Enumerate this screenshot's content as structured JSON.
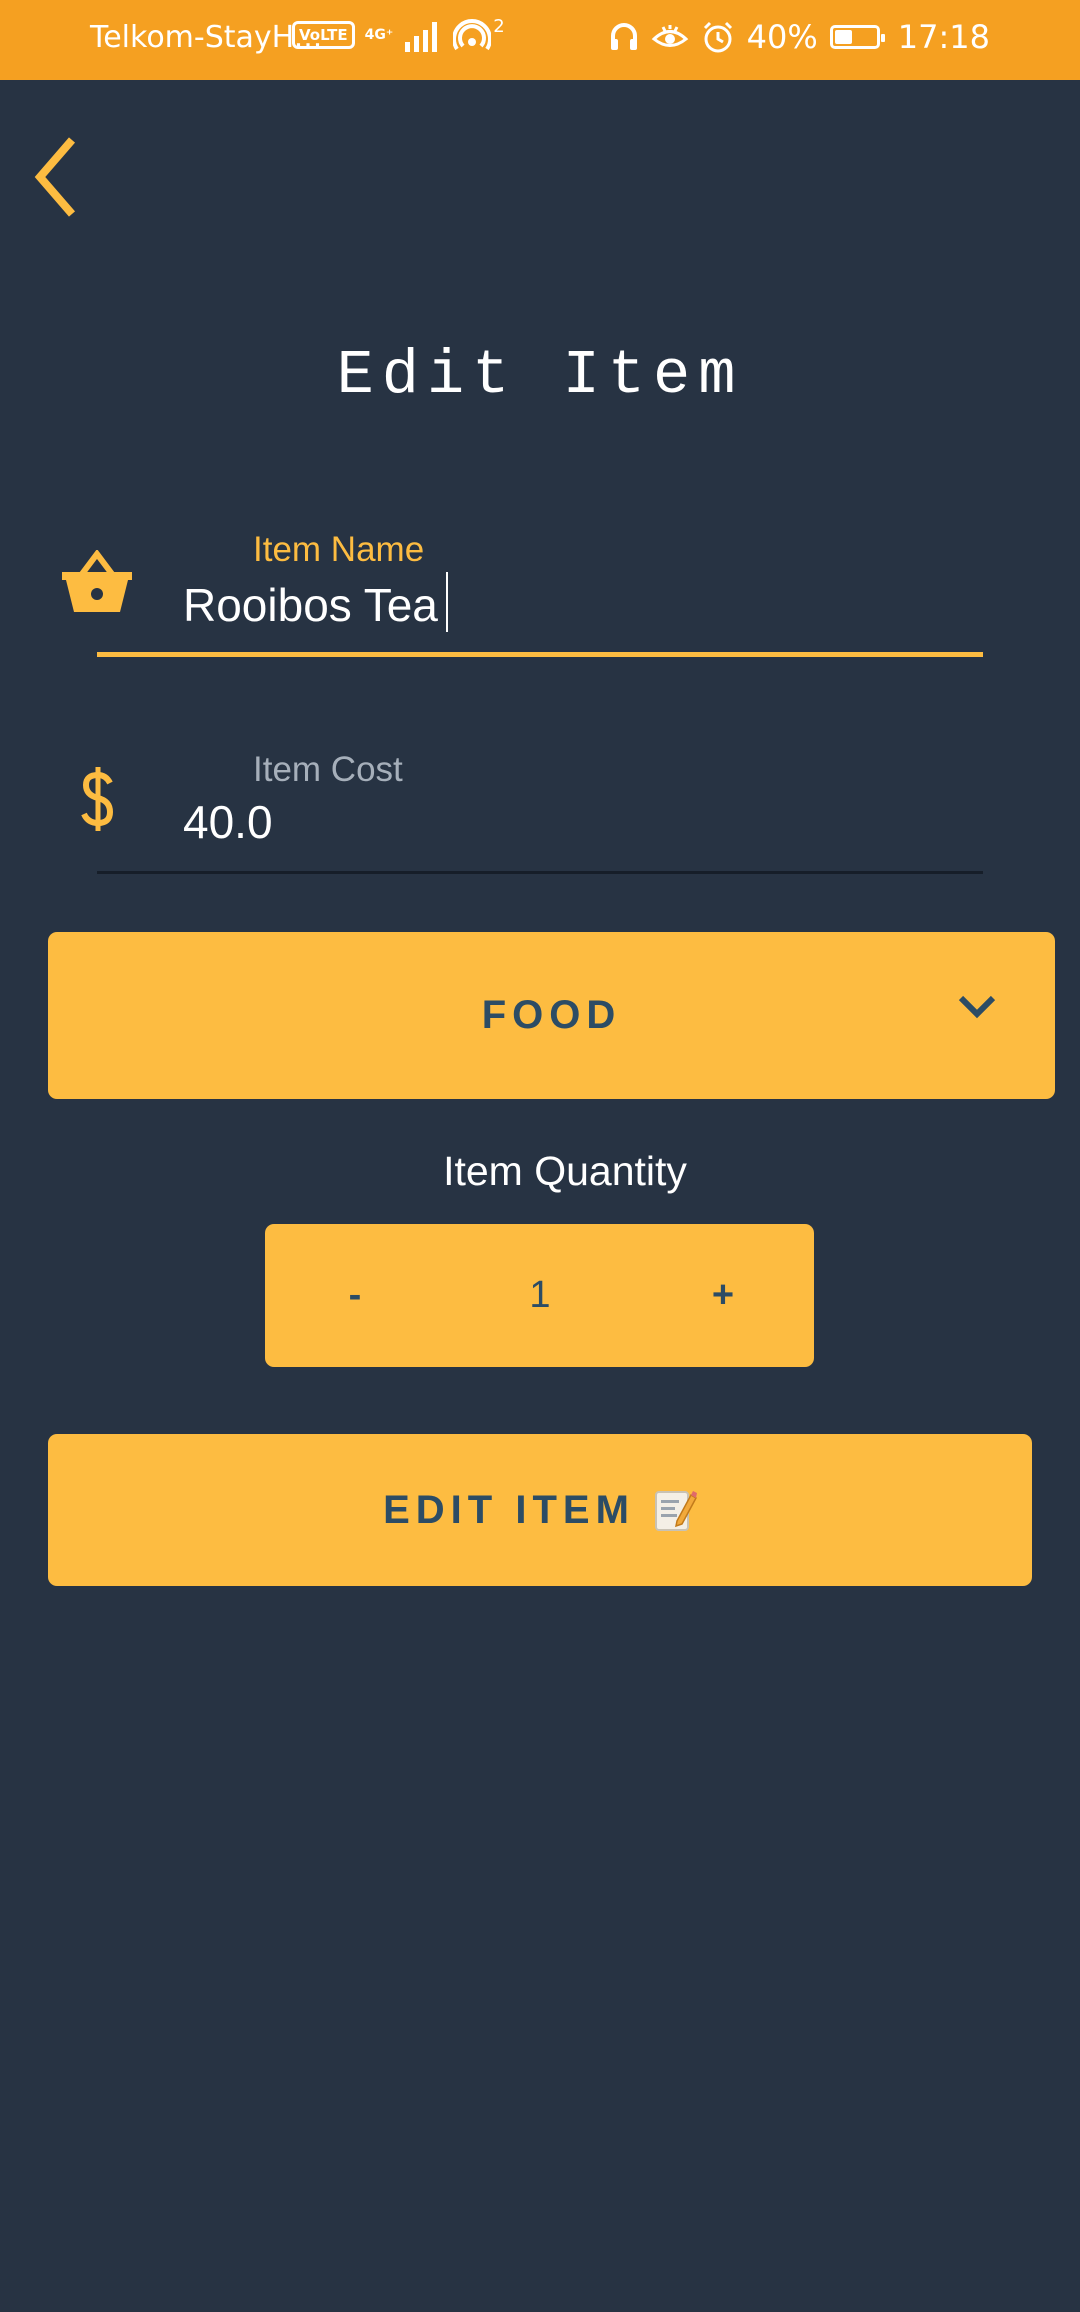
{
  "status_bar": {
    "carrier": "Telkom-StayH...",
    "volte_badge": "VoLTE",
    "network_type": "4G⁺",
    "hotspot_count": "2",
    "battery_percent": "40%",
    "battery_level": 0.4,
    "time": "17:18",
    "icons": [
      "volte-icon",
      "signal-icon",
      "hotspot-icon",
      "headset-icon",
      "eye-icon",
      "alarm-icon",
      "battery-icon"
    ]
  },
  "nav": {
    "back_icon": "chevron-left-icon"
  },
  "page": {
    "title": "Edit Item"
  },
  "form": {
    "item_name": {
      "label": "Item Name",
      "value": "Rooibos Tea",
      "icon": "basket-icon",
      "focused": true
    },
    "item_cost": {
      "label": "Item Cost",
      "value": "40.0",
      "icon": "dollar-icon",
      "focused": false
    },
    "category": {
      "selected": "FOOD",
      "icon": "chevron-down-icon"
    },
    "quantity": {
      "label": "Item Quantity",
      "decrement": "-",
      "value": "1",
      "increment": "+"
    },
    "submit": {
      "label": "EDIT ITEM",
      "icon": "memo-icon"
    }
  },
  "colors": {
    "status_bar": "#F5A021",
    "background": "#273343",
    "accent": "#FDBC41",
    "accent_text": "#2C4C65",
    "inactive_label": "#A6AFBA",
    "text": "#FFFFFF"
  }
}
